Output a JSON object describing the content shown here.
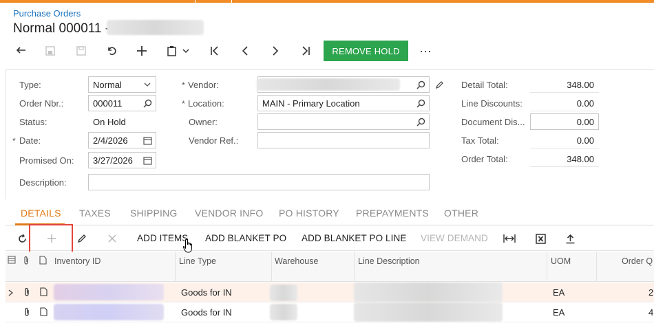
{
  "header": {
    "breadcrumb": "Purchase Orders",
    "title": "Normal 000011 -"
  },
  "toolbar": {
    "remove_hold_label": "REMOVE HOLD",
    "more_label": "···",
    "icons": [
      "back-icon",
      "copy-icon",
      "save-icon",
      "undo-icon",
      "add-icon",
      "clipboard-icon",
      "chevron-down-icon",
      "first-icon",
      "previous-icon",
      "next-icon",
      "last-icon"
    ]
  },
  "form": {
    "type_label": "Type:",
    "type_value": "Normal",
    "order_nbr_label": "Order Nbr.:",
    "order_nbr_value": "000011",
    "status_label": "Status:",
    "status_value": "On Hold",
    "date_label": "Date:",
    "date_value": "2/4/2026",
    "promised_on_label": "Promised On:",
    "promised_on_value": "3/27/2026",
    "description_label": "Description:",
    "description_value": "",
    "vendor_label": "Vendor:",
    "vendor_value": "",
    "location_label": "Location:",
    "location_value": "MAIN - Primary Location",
    "owner_label": "Owner:",
    "owner_value": "",
    "vendor_ref_label": "Vendor Ref.:",
    "vendor_ref_value": "",
    "required_mark": "*"
  },
  "totals": {
    "detail_total_label": "Detail Total:",
    "detail_total_value": "348.00",
    "line_discounts_label": "Line Discounts:",
    "line_discounts_value": "0.00",
    "document_dis_label": "Document Dis...",
    "document_dis_value": "0.00",
    "tax_total_label": "Tax Total:",
    "tax_total_value": "0.00",
    "order_total_label": "Order Total:",
    "order_total_value": "348.00"
  },
  "tabs": [
    "DETAILS",
    "TAXES",
    "SHIPPING",
    "VENDOR INFO",
    "PO HISTORY",
    "PREPAYMENTS",
    "OTHER"
  ],
  "grid_toolbar": {
    "add_items": "ADD ITEMS",
    "add_blanket_po": "ADD BLANKET PO",
    "add_blanket_po_line": "ADD BLANKET PO LINE",
    "view_demand": "VIEW DEMAND"
  },
  "grid": {
    "columns": [
      "Inventory ID",
      "Line Type",
      "Warehouse",
      "Line Description",
      "UOM",
      "Order Q"
    ],
    "rows": [
      {
        "line_type": "Goods for IN",
        "uom": "EA",
        "qty": "2"
      },
      {
        "line_type": "Goods for IN",
        "uom": "EA",
        "qty": "4"
      }
    ]
  },
  "colors": {
    "accent": "#e07a16",
    "primary_button": "#2da44e",
    "link": "#1a73c0",
    "highlight": "#e2453c"
  }
}
